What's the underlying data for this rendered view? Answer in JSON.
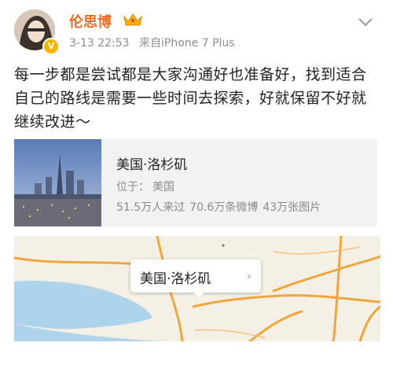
{
  "post": {
    "username": "伦思博",
    "timestamp": "3-13 22:53",
    "source": "来自iPhone 7 Plus",
    "verified_badge": "V",
    "text": "每一步都是尝试都是大家沟通好也准备好，找到适合自己的路线是需要一些时间去探索，好就保留不好就继续改进～"
  },
  "location_card": {
    "title": "美国·洛杉矶",
    "location_label": "位于：",
    "location_value": "美国",
    "visitors": "51.5万人来过",
    "posts": "70.6万条微博",
    "photos": "43万张图片"
  },
  "map": {
    "callout_label": "美国·洛杉矶",
    "callout_arrow": "›"
  },
  "icons": {
    "menu": "chevron-down-icon",
    "vip": "crown-icon",
    "verified": "verified-badge-icon"
  },
  "colors": {
    "username": "#f06b23",
    "badge": "#f6b400",
    "card_bg": "#f2f2f2",
    "map_land": "#f4f0e6",
    "map_water": "#aed4ec",
    "map_road": "#f0a63c"
  }
}
